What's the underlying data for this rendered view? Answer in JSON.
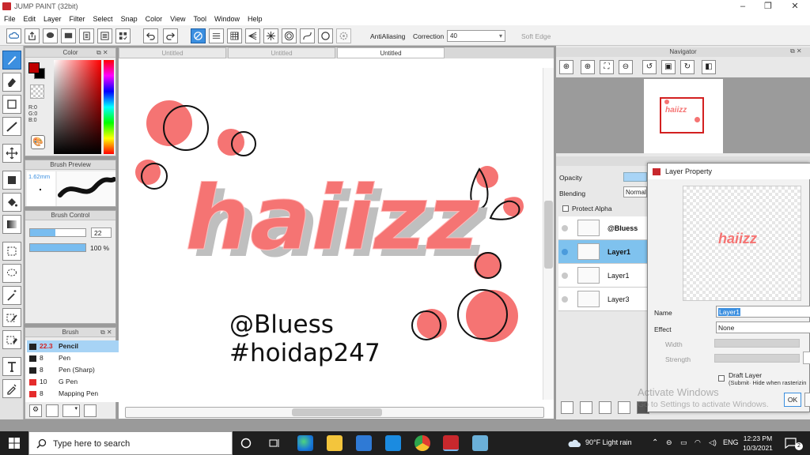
{
  "window": {
    "title": "JUMP PAINT (32bit)"
  },
  "menu": [
    "File",
    "Edit",
    "Layer",
    "Filter",
    "Select",
    "Snap",
    "Color",
    "View",
    "Tool",
    "Window",
    "Help"
  ],
  "toolbar": {
    "antialiasing_label": "AntiAliasing",
    "correction_label": "Correction",
    "correction_value": "40",
    "softedge_label": "Soft Edge"
  },
  "color_panel": {
    "title": "Color",
    "r": "R:0",
    "g": "G:0",
    "b": "B:0",
    "fg": "#c00000",
    "bg": "#000000"
  },
  "brush_preview": {
    "title": "Brush Preview",
    "size": "1.62mm"
  },
  "brush_control": {
    "title": "Brush Control",
    "size": "22",
    "opacity": "100 %"
  },
  "brush_panel": {
    "title": "Brush",
    "items": [
      {
        "size": "22.3",
        "name": "Pencil",
        "color": "#222222",
        "selected": true
      },
      {
        "size": "8",
        "name": "Pen",
        "color": "#222222"
      },
      {
        "size": "8",
        "name": "Pen (Sharp)",
        "color": "#222222"
      },
      {
        "size": "10",
        "name": "G Pen",
        "color": "#e52b2b"
      },
      {
        "size": "8",
        "name": "Mapping Pen",
        "color": "#e52b2b"
      }
    ]
  },
  "tabs": [
    "Untitled",
    "Untitled",
    "Untitled"
  ],
  "canvas": {
    "artwork_text": "haiizz",
    "credit1": "@Bluess",
    "credit2": "#hoidap247"
  },
  "navigator": {
    "title": "Navigator"
  },
  "layers": {
    "opacity_label": "Opacity",
    "blending_label": "Blending",
    "blending_value": "Normal",
    "protect_alpha_label": "Protect Alpha",
    "rows": [
      {
        "name": "@Bluess",
        "bold": true,
        "selected": false
      },
      {
        "name": "Layer1",
        "bold": true,
        "selected": true
      },
      {
        "name": "Layer1",
        "bold": false,
        "selected": false
      },
      {
        "name": "Layer3",
        "bold": false,
        "selected": false
      }
    ]
  },
  "layer_property": {
    "title": "Layer Property",
    "name_label": "Name",
    "name_value": "Layer1",
    "effect_label": "Effect",
    "effect_value": "None",
    "width_label": "Width",
    "strength_label": "Strength",
    "draft_label": "Draft Layer",
    "draft_note": "(Submit· Hide when rasterizin",
    "ok_label": "OK"
  },
  "watermark": {
    "line1": "Activate Windows",
    "line2": "Go to Settings to activate Windows."
  },
  "taskbar": {
    "search_placeholder": "Type here to search",
    "weather": "90°F  Light rain",
    "lang": "ENG",
    "time": "12:23 PM",
    "date": "10/3/2021",
    "notif_count": "2"
  },
  "colors": {
    "accent": "#3b8fe0",
    "coral": "#f57473",
    "selected_layer": "#7fc2ee"
  }
}
